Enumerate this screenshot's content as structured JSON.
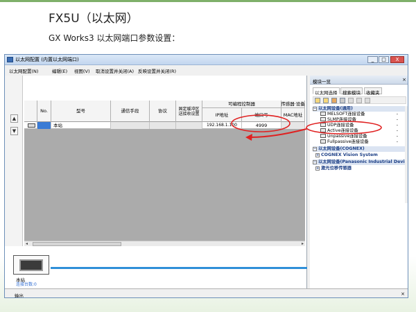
{
  "slide": {
    "title": "FX5U（以太网）",
    "subtitle": "GX Works3 以太网端口参数设置："
  },
  "window": {
    "title": "以太网配置 (内置以太网端口)",
    "minimize": "_",
    "maximize": "□",
    "close": "X"
  },
  "menu": {
    "items": [
      "以太网配置(N)",
      "编辑(E)",
      "视图(V)",
      "取消设置并关闭(A)",
      "反映设置并关闭(R)"
    ]
  },
  "grid": {
    "headers": {
      "no": "No.",
      "model": "型号",
      "comm": "通信手段",
      "protocol": "协议",
      "fixed_buffer": "固定缓冲区 送接收设置",
      "plc_group": "可编程控制器",
      "ip": "IP地址",
      "port": "端口号",
      "sensor_group": "传感器·设备",
      "mac": "MAC地址"
    },
    "rows": [
      {
        "no": "",
        "model": "本站",
        "comm": "",
        "protocol": "",
        "fixed_buffer": "",
        "ip": "192.168.1.100",
        "port": "4999",
        "mac": ""
      }
    ],
    "up_arrow": "▲",
    "down_arrow": "▼"
  },
  "network": {
    "station_label": "本站",
    "connected_count": "连接台数:0"
  },
  "module_panel": {
    "title": "模块一览",
    "close": "×",
    "tabs": [
      "以太网选择",
      "搜索模块",
      "收藏夹"
    ],
    "tree": [
      {
        "type": "cat",
        "label": "以太网设备(通用)"
      },
      {
        "type": "item",
        "label": "MELSOFT连接设备",
        "dash": "-"
      },
      {
        "type": "item",
        "label": "SLMP连接设备",
        "dash": "-"
      },
      {
        "type": "item",
        "label": "UDP连接设备",
        "dash": "-"
      },
      {
        "type": "item",
        "label": "Active连接设备",
        "dash": "-"
      },
      {
        "type": "item",
        "label": "Unpassive连接设备",
        "dash": "-"
      },
      {
        "type": "item",
        "label": "Fullpassive连接设备",
        "dash": "-"
      },
      {
        "type": "cat",
        "label": "以太网设备(COGNEX)"
      },
      {
        "type": "sub",
        "label": "COGNEX Vision System"
      },
      {
        "type": "cat",
        "label": "以太网设备(Panasonic Industrial Devi"
      },
      {
        "type": "sub",
        "label": "激光位移传感器"
      }
    ]
  },
  "output": {
    "label": "输出",
    "close": "×"
  },
  "colors": {
    "annotation_red": "#e02020",
    "network_blue": "#2f8fd8",
    "tree_blue": "#1c3f86"
  }
}
